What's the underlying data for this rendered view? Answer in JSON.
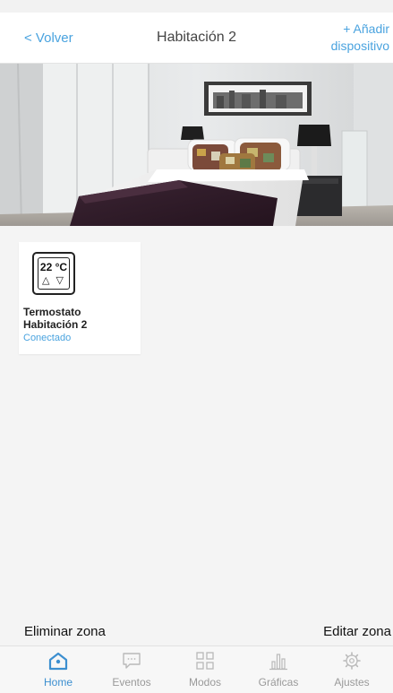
{
  "header": {
    "back_label": "< Volver",
    "title": "Habitación 2",
    "add_line1": "+ Añadir",
    "add_line2": "dispositivo"
  },
  "device": {
    "icon_temp": "22 °C",
    "icon_arrows": "△ ▽",
    "name": "Termostato Habitación 2",
    "status": "Conectado",
    "icon": "thermostat-icon"
  },
  "actions": {
    "delete_zone": "Eliminar zona",
    "edit_zone": "Editar zona"
  },
  "tabs": [
    {
      "label": "Home",
      "icon": "home-icon",
      "active": true
    },
    {
      "label": "Eventos",
      "icon": "chat-icon",
      "active": false
    },
    {
      "label": "Modos",
      "icon": "grid-icon",
      "active": false
    },
    {
      "label": "Gráficas",
      "icon": "bar-chart-icon",
      "active": false
    },
    {
      "label": "Ajustes",
      "icon": "gear-icon",
      "active": false
    }
  ],
  "colors": {
    "accent": "#4aa3df",
    "active_tab": "#3c8fd0",
    "inactive_tab": "#9a9a9a",
    "background": "#f4f4f4"
  }
}
